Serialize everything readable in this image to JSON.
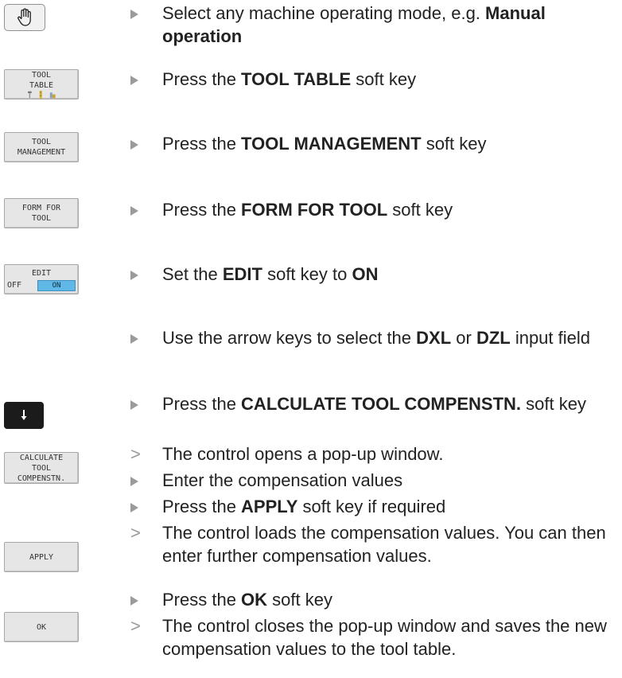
{
  "keys": {
    "tool_table": [
      "TOOL",
      "TABLE"
    ],
    "tool_management": [
      "TOOL",
      "MANAGEMENT"
    ],
    "form_for_tool": [
      "FORM FOR",
      "TOOL"
    ],
    "edit": {
      "label": "EDIT",
      "off": "OFF",
      "on": "ON"
    },
    "calculate": [
      "CALCULATE",
      "TOOL",
      "COMPENSTN."
    ],
    "apply": "APPLY",
    "ok": "OK"
  },
  "steps": [
    {
      "type": "action",
      "parts": [
        "Select any machine operating mode, e.g. ",
        "Manual operation"
      ]
    },
    {
      "type": "action",
      "parts": [
        "Press the ",
        "TOOL TABLE",
        " soft key"
      ]
    },
    {
      "type": "action",
      "parts": [
        "Press the ",
        "TOOL MANAGEMENT",
        " soft key"
      ]
    },
    {
      "type": "action",
      "parts": [
        "Press the ",
        "FORM FOR TOOL",
        " soft key"
      ]
    },
    {
      "type": "action",
      "parts": [
        "Set the ",
        "EDIT",
        " soft key to ",
        "ON"
      ]
    },
    {
      "type": "action",
      "parts": [
        "Use the arrow keys to select the ",
        "DXL",
        " or ",
        "DZL",
        " input field"
      ]
    },
    {
      "type": "action",
      "parts": [
        "Press the ",
        "CALCULATE TOOL COMPENSTN.",
        " soft key"
      ]
    },
    {
      "type": "result",
      "parts": [
        "The control opens a pop-up window."
      ]
    },
    {
      "type": "action",
      "parts": [
        "Enter the compensation values"
      ]
    },
    {
      "type": "action",
      "parts": [
        "Press the ",
        "APPLY",
        " soft key if required"
      ]
    },
    {
      "type": "result",
      "parts": [
        "The control loads the compensation values. You can then enter further compensation values."
      ]
    },
    {
      "type": "action",
      "parts": [
        "Press the ",
        "OK",
        " soft key"
      ]
    },
    {
      "type": "result",
      "parts": [
        "The control closes the pop-up window and saves the new compensation values to the tool table."
      ]
    }
  ],
  "marks": {
    "result": ">"
  },
  "icons": {
    "manual_mode": "hand-icon",
    "arrow": "arrow-down-icon"
  }
}
